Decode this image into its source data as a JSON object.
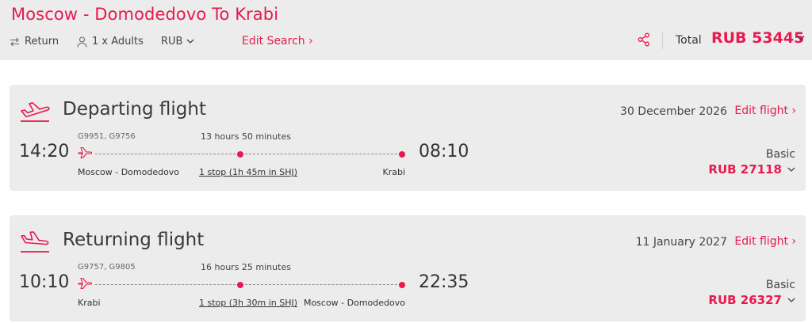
{
  "header": {
    "route_title": "Moscow - Domodedovo To Krabi",
    "trip_type": "Return",
    "passengers": "1 x Adults",
    "currency": "RUB",
    "edit_search": "Edit Search ›",
    "total_label": "Total",
    "total_price": "RUB 53445"
  },
  "departing": {
    "title": "Departing flight",
    "date": "30 December 2026",
    "edit_label": "Edit flight ›",
    "flight_numbers": "G9951, G9756",
    "duration": "13 hours 50 minutes",
    "dep_time": "14:20",
    "arr_time": "08:10",
    "from": "Moscow - Domodedovo",
    "stops": "1 stop (1h 45m in SHJ)",
    "to": "Krabi",
    "fare_class": "Basic",
    "fare_price": "RUB 27118"
  },
  "returning": {
    "title": "Returning flight",
    "date": "11 January 2027",
    "edit_label": "Edit flight ›",
    "flight_numbers": "G9757, G9805",
    "duration": "16 hours 25 minutes",
    "dep_time": "10:10",
    "arr_time": "22:35",
    "from": "Krabi",
    "stops": "1 stop (3h 30m in SHJ)",
    "to": "Moscow - Domodedovo",
    "fare_class": "Basic",
    "fare_price": "RUB 26327"
  },
  "colors": {
    "accent": "#e8194f",
    "panel": "#ececec",
    "text": "#333333"
  },
  "icons": [
    "swap-arrows-icon",
    "person-icon",
    "chevron-down-icon",
    "share-icon",
    "takeoff-icon",
    "landing-icon",
    "plane-icon"
  ]
}
